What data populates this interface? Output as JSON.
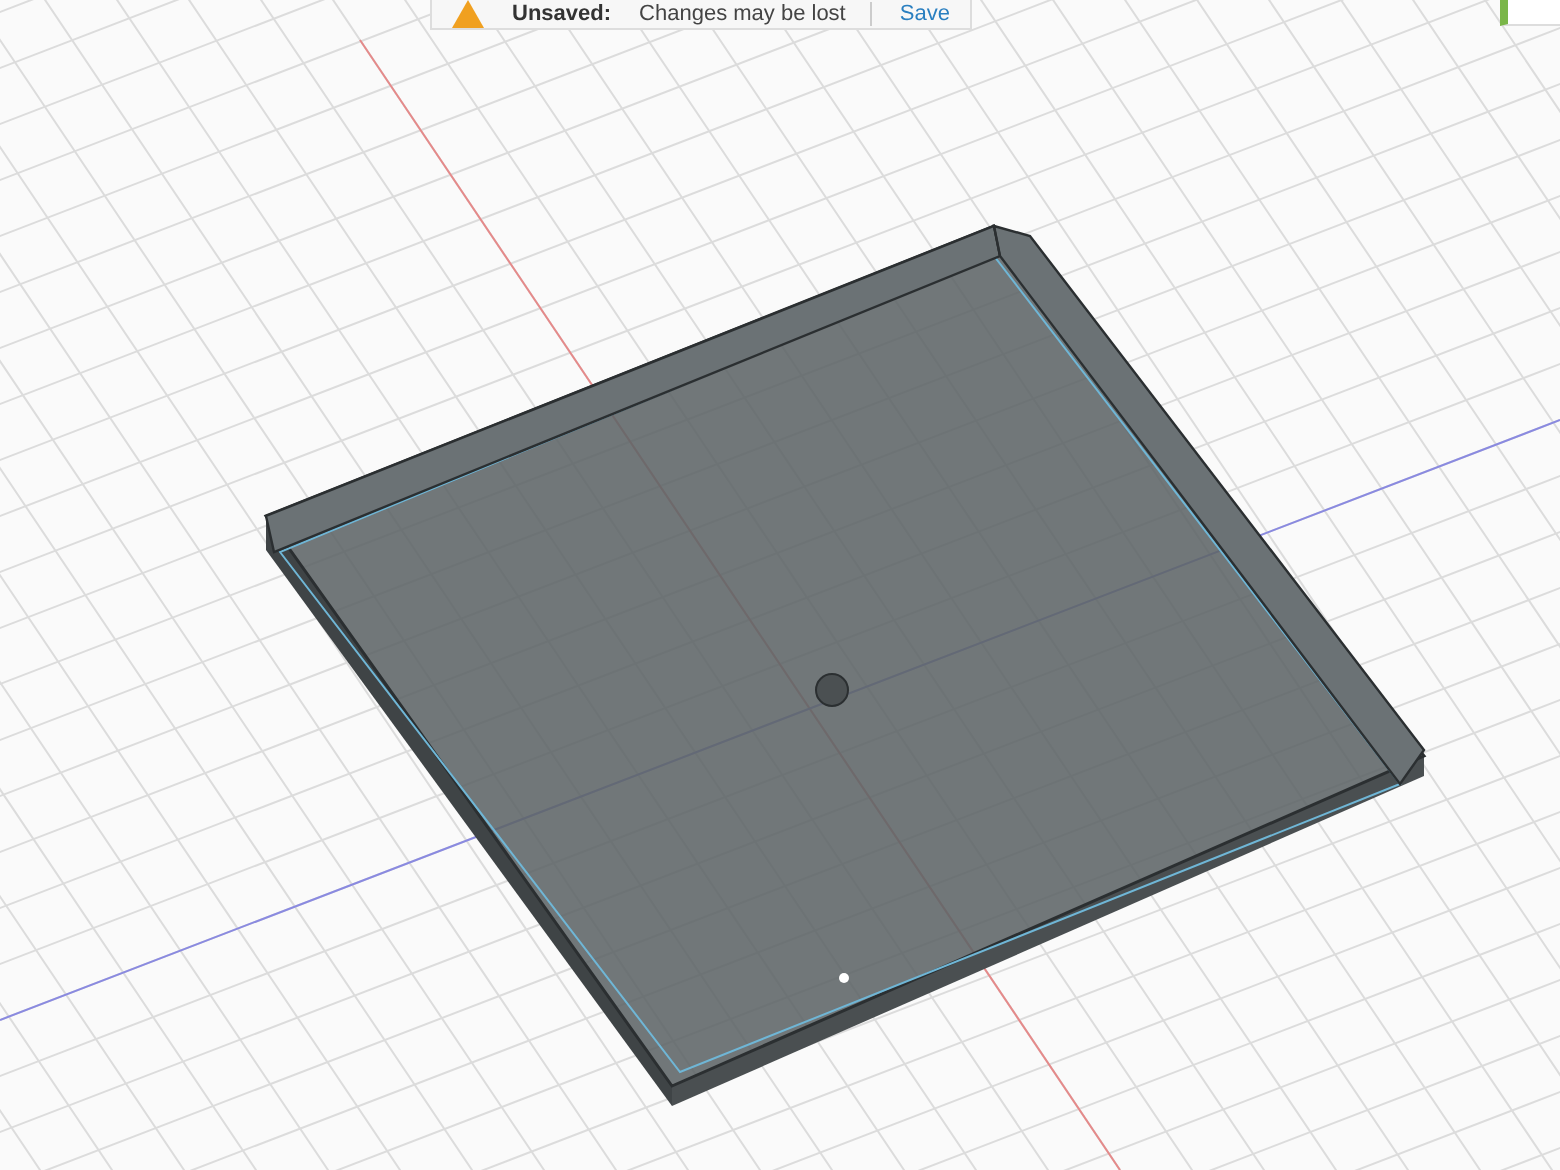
{
  "notification": {
    "label": "Unsaved:",
    "message": "Changes may be lost",
    "action": "Save"
  }
}
